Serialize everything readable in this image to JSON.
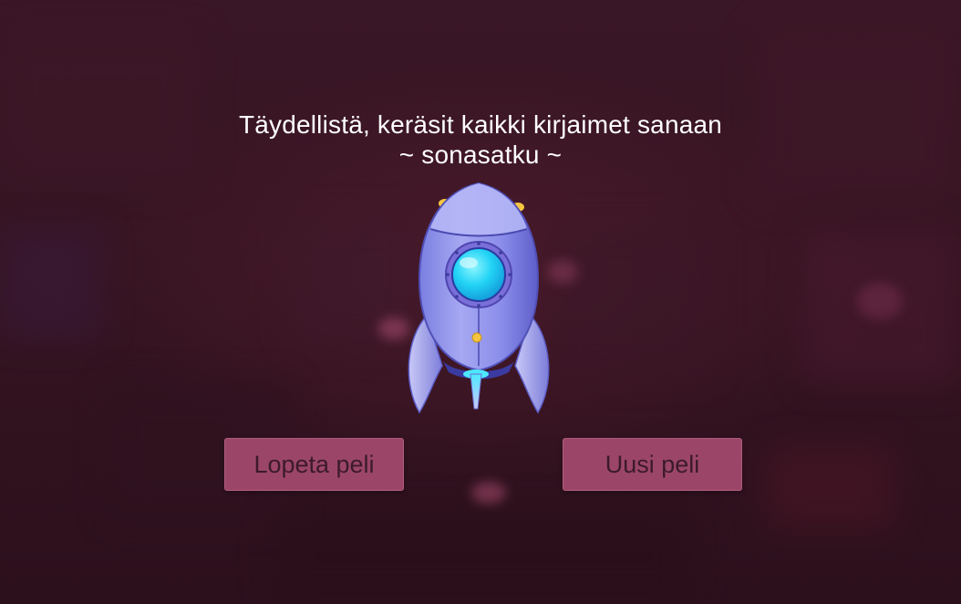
{
  "colors": {
    "background": "#2e121f",
    "button": "#9b4668",
    "button_text": "#3c1a2a",
    "message_text": "#ffffff"
  },
  "message": {
    "line1": "Täydellistä, keräsit kaikki kirjaimet sanaan",
    "line2": "~ sonasatku ~"
  },
  "illustration": {
    "icon": "rocket-icon"
  },
  "buttons": {
    "quit_label": "Lopeta peli",
    "new_game_label": "Uusi peli"
  }
}
